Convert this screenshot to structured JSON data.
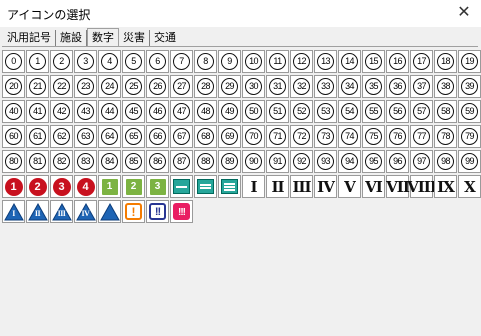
{
  "window": {
    "title": "アイコンの選択",
    "close_icon": "close-icon"
  },
  "tabs": [
    {
      "label": "汎用記号",
      "active": false
    },
    {
      "label": "施設",
      "active": false
    },
    {
      "label": "数字",
      "active": true
    },
    {
      "label": "災害",
      "active": false
    },
    {
      "label": "交通",
      "active": false
    }
  ],
  "numbers": [
    "0",
    "1",
    "2",
    "3",
    "4",
    "5",
    "6",
    "7",
    "8",
    "9",
    "10",
    "11",
    "12",
    "13",
    "14",
    "15",
    "16",
    "17",
    "18",
    "19",
    "20",
    "21",
    "22",
    "23",
    "24",
    "25",
    "26",
    "27",
    "28",
    "29",
    "30",
    "31",
    "32",
    "33",
    "34",
    "35",
    "36",
    "37",
    "38",
    "39",
    "40",
    "41",
    "42",
    "43",
    "44",
    "45",
    "46",
    "47",
    "48",
    "49",
    "50",
    "51",
    "52",
    "53",
    "54",
    "55",
    "56",
    "57",
    "58",
    "59",
    "60",
    "61",
    "62",
    "63",
    "64",
    "65",
    "66",
    "67",
    "68",
    "69",
    "70",
    "71",
    "72",
    "73",
    "74",
    "75",
    "76",
    "77",
    "78",
    "79",
    "80",
    "81",
    "82",
    "83",
    "84",
    "85",
    "86",
    "87",
    "88",
    "89",
    "90",
    "91",
    "92",
    "93",
    "94",
    "95",
    "96",
    "97",
    "98",
    "99"
  ],
  "red_circles": [
    "1",
    "2",
    "3",
    "4"
  ],
  "green_squares": [
    "1",
    "2",
    "3"
  ],
  "roman": [
    "I",
    "II",
    "III",
    "IV",
    "V",
    "VI",
    "VII",
    "VIII",
    "IX",
    "X"
  ],
  "triangles": [
    "I",
    "II",
    "III",
    "IV",
    ""
  ],
  "warnings": [
    "!",
    "!!",
    "!!!"
  ],
  "colors": {
    "red": "#c8101e",
    "green": "#7cb342",
    "teal": "#26a69a",
    "blue": "#1e64b4",
    "orange": "#f57c00",
    "navy": "#283593",
    "pink": "#e91e63"
  }
}
